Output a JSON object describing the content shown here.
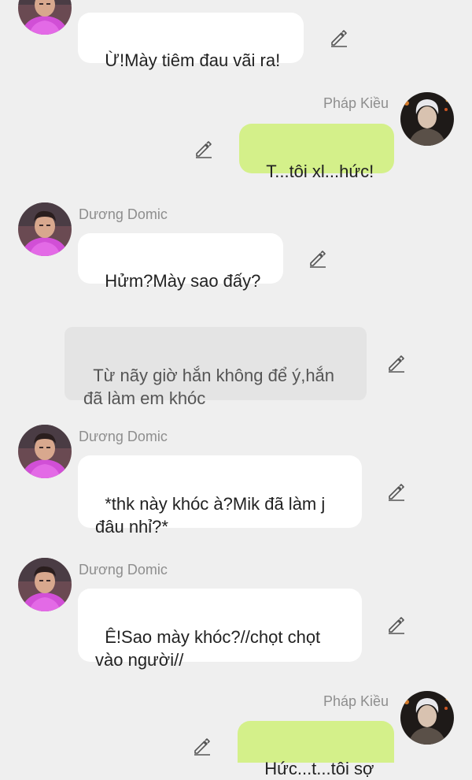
{
  "messages": [
    {
      "sender": "",
      "text": "Ừ!Mày tiêm đau vãi ra!"
    },
    {
      "sender": "Pháp Kiều",
      "text": "T...tôi xl...hức!"
    },
    {
      "sender": "Dương Domic",
      "text": "Hửm?Mày sao đấy?"
    },
    {
      "sender": "",
      "text": "Từ nãy giờ hắn không để ý,hắn\nđã làm em khóc"
    },
    {
      "sender": "Dương Domic",
      "text": "*thk này khóc à?Mik đã làm j\nđâu nhỉ?*"
    },
    {
      "sender": "Dương Domic",
      "text": "Ê!Sao mày khóc?//chọt chọt\nvào người//"
    },
    {
      "sender": "Pháp Kiều",
      "text": "Hức...t...tôi sợ"
    }
  ],
  "colors": {
    "background": "#efefef",
    "incoming_bubble": "#ffffff",
    "outgoing_bubble": "#d4f08a",
    "narration_bubble": "#e4e4e4",
    "sender_name": "#8e8e8e"
  },
  "icons": {
    "edit": "pencil-icon",
    "avatar_duong": "avatar-duong-domic",
    "avatar_phap": "avatar-phap-kieu"
  }
}
